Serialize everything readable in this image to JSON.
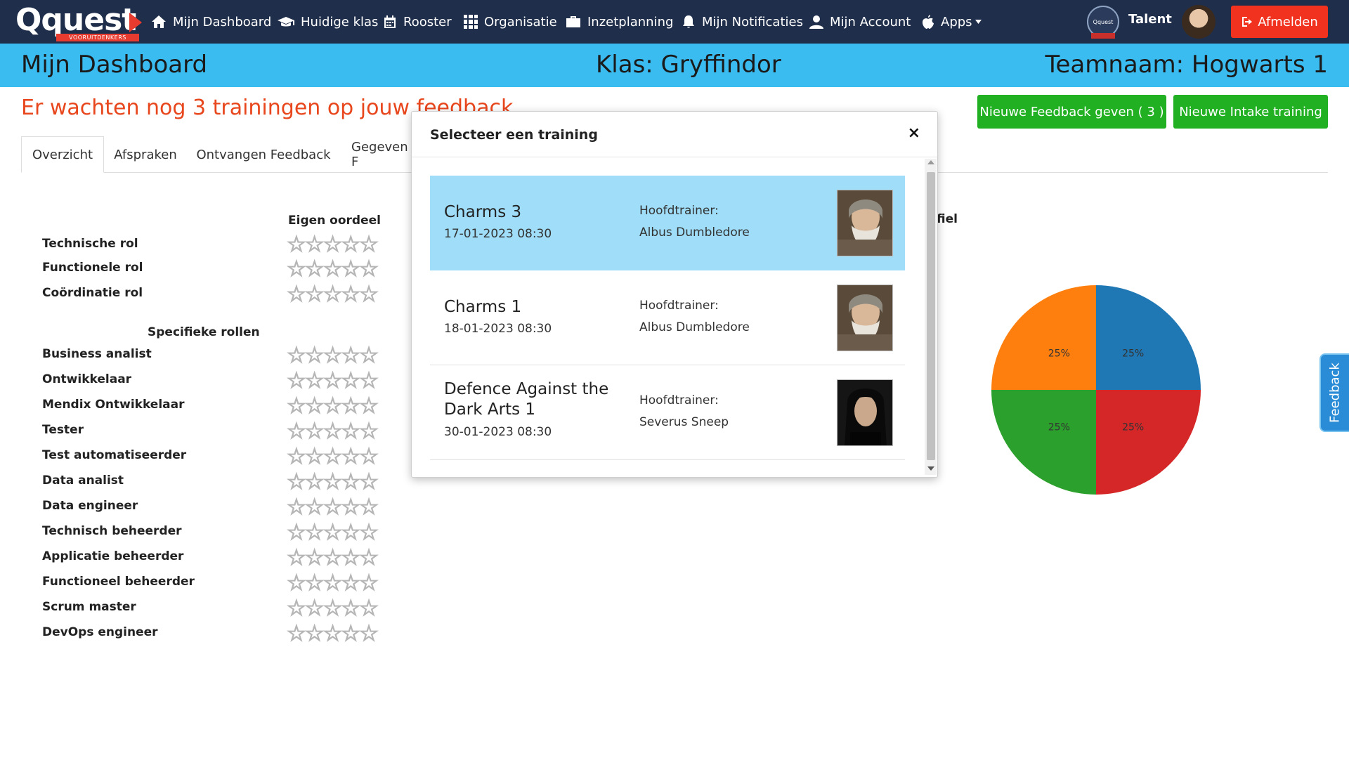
{
  "nav": {
    "logo": "Qquest",
    "logo_sub": "VOORUITDENKERS",
    "items": [
      {
        "label": "Mijn Dashboard",
        "icon": "home-icon"
      },
      {
        "label": "Huidige klas",
        "icon": "graduation-cap-icon"
      },
      {
        "label": "Rooster",
        "icon": "calendar-icon"
      },
      {
        "label": "Organisatie",
        "icon": "grid-icon"
      },
      {
        "label": "Inzetplanning",
        "icon": "briefcase-icon"
      },
      {
        "label": "Mijn Notificaties",
        "icon": "bell-icon"
      },
      {
        "label": "Mijn Account",
        "icon": "user-icon"
      },
      {
        "label": "Apps",
        "icon": "apple-icon"
      }
    ],
    "badge_text": "Qquest",
    "talent_label": "Talent",
    "logout_label": "Afmelden"
  },
  "header": {
    "page_title": "Mijn Dashboard",
    "class_label": "Klas: Gryffindor",
    "team_label": "Teamnaam: Hogwarts 1"
  },
  "alert": {
    "text": "Er wachten nog 3 trainingen op jouw feedback"
  },
  "actions": {
    "feedback_button": "Nieuwe Feedback geven ( 3 )",
    "intake_button": "Nieuwe Intake training"
  },
  "tabs": [
    "Overzicht",
    "Afspraken",
    "Ontvangen Feedback",
    "Gegeven F"
  ],
  "roles": {
    "own_judgement_header": "Eigen oordeel",
    "general": [
      "Technische rol",
      "Functionele rol",
      "Coördinatie rol"
    ],
    "specific_header": "Specifieke rollen",
    "specific": [
      "Business analist",
      "Ontwikkelaar",
      "Mendix Ontwikkelaar",
      "Tester",
      "Test automatiseerder",
      "Data analist",
      "Data engineer",
      "Technisch beheerder",
      "Applicatie beheerder",
      "Functioneel beheerder",
      "Scrum master",
      "DevOps engineer"
    ],
    "stars": "☆☆☆☆☆",
    "max_rating": 5,
    "rating": 0
  },
  "profile_header_fragment": "fiel",
  "chart_data": {
    "type": "pie",
    "slices": [
      {
        "label": "25%",
        "value": 25,
        "color": "#1f77b4"
      },
      {
        "label": "25%",
        "value": 25,
        "color": "#d62728"
      },
      {
        "label": "25%",
        "value": 25,
        "color": "#2ca02c"
      },
      {
        "label": "25%",
        "value": 25,
        "color": "#ff7f0e"
      }
    ]
  },
  "feedback_tab": "Feedback",
  "modal": {
    "title": "Selecteer een training",
    "close": "×",
    "trainer_label": "Hoofdtrainer:",
    "trainings": [
      {
        "name": "Charms 3",
        "date": "17-01-2023 08:30",
        "trainer": "Albus Dumbledore",
        "selected": true
      },
      {
        "name": "Charms 1",
        "date": "18-01-2023 08:30",
        "trainer": "Albus Dumbledore",
        "selected": false
      },
      {
        "name": "Defence Against the Dark Arts 1",
        "date": "30-01-2023 08:30",
        "trainer": "Severus Sneep",
        "selected": false
      }
    ]
  },
  "colors": {
    "nav_bg": "#1f2e4a",
    "header_bg": "#3bbcf1",
    "alert": "#e8461c",
    "green": "#20b022",
    "logout": "#f0321e",
    "selected_row": "#9fddf8"
  }
}
